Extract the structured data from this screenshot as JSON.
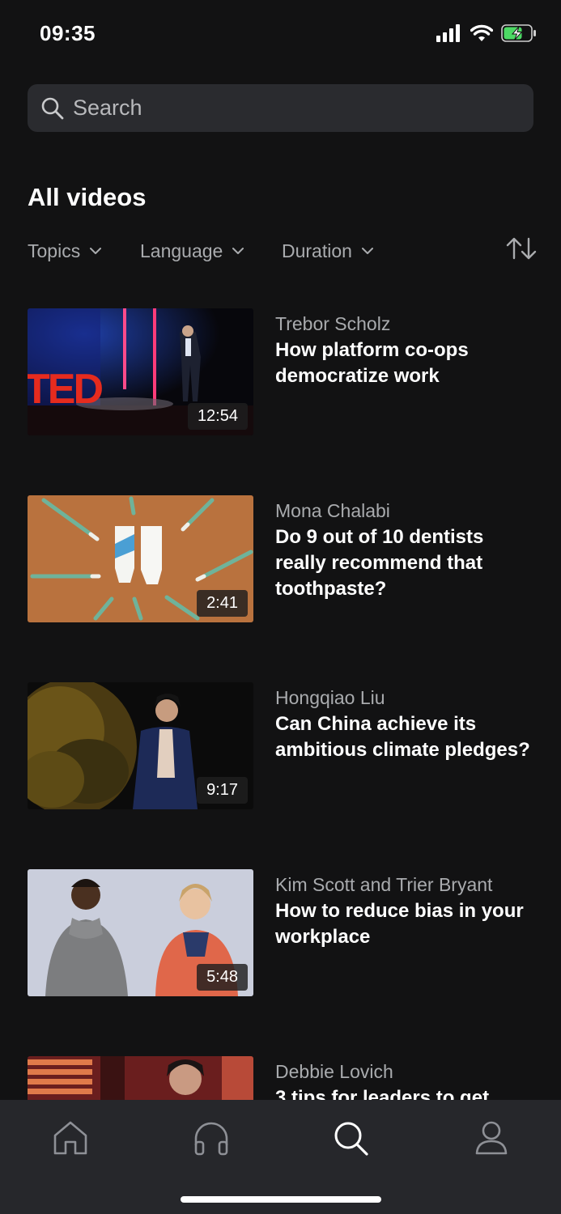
{
  "status_bar": {
    "time": "09:35",
    "icons": [
      "signal-icon",
      "wifi-icon",
      "battery-charging-icon"
    ]
  },
  "search": {
    "placeholder": "Search"
  },
  "page_title": "All videos",
  "filters": [
    {
      "label": "Topics"
    },
    {
      "label": "Language"
    },
    {
      "label": "Duration"
    }
  ],
  "sort_icon": "sort-arrows-icon",
  "videos": [
    {
      "speaker": "Trebor Scholz",
      "title": "How platform co-ops democratize work",
      "duration": "12:54",
      "thumbnail_brand_text": "TED"
    },
    {
      "speaker": "Mona Chalabi",
      "title": "Do 9 out of 10 dentists really recommend that toothpaste?",
      "duration": "2:41"
    },
    {
      "speaker": "Hongqiao Liu",
      "title": "Can China achieve its ambitious climate pledges?",
      "duration": "9:17"
    },
    {
      "speaker": "Kim Scott and Trier Bryant",
      "title": "How to reduce bias in your workplace",
      "duration": "5:48"
    },
    {
      "speaker": "Debbie Lovich",
      "title": "3 tips for leaders to get"
    }
  ],
  "tab_bar": {
    "tabs": [
      {
        "icon": "home-icon",
        "active": false
      },
      {
        "icon": "headphones-icon",
        "active": false
      },
      {
        "icon": "search-icon",
        "active": true
      },
      {
        "icon": "profile-icon",
        "active": false
      }
    ]
  },
  "colors": {
    "background": "#121213",
    "surface": "#2a2b2f",
    "tab_bar": "#26272b",
    "text_primary": "#ffffff",
    "text_secondary": "#a9abae",
    "ted_red": "#e62b1e"
  }
}
